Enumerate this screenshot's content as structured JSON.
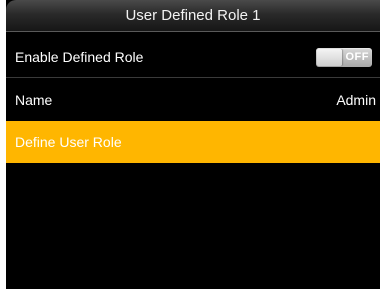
{
  "header": {
    "title": "User Defined Role 1"
  },
  "settings": {
    "enable_label": "Enable Defined Role",
    "enable_toggle_text": "OFF",
    "enable_state": false,
    "name_label": "Name",
    "name_value": "Admin",
    "define_label": "Define User Role"
  },
  "colors": {
    "highlight": "#ffb600",
    "background": "#000000",
    "text": "#ffffff"
  }
}
